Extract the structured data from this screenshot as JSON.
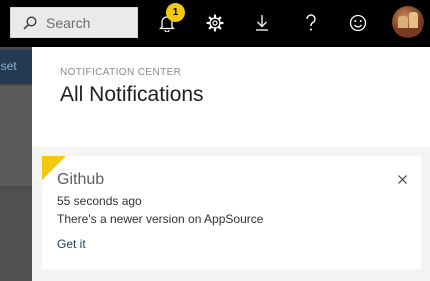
{
  "header": {
    "search_placeholder": "Search",
    "notification_count": "1"
  },
  "background": {
    "partial_label": "eset"
  },
  "notification_center": {
    "eyebrow": "NOTIFICATION CENTER",
    "title": "All Notifications",
    "notifications": [
      {
        "title": "Github",
        "time": "55 seconds ago",
        "message": "There's a newer version on AppSource",
        "action": "Get it",
        "accent_color": "#f2c811"
      }
    ]
  },
  "icons": {
    "search": "search-icon",
    "bell": "bell-icon",
    "settings": "gear-icon",
    "download": "download-icon",
    "help": "question-icon",
    "feedback": "smiley-icon",
    "close": "close-icon"
  },
  "colors": {
    "topbar": "#000000",
    "badge": "#f2c811",
    "panel_bg": "#f4f4f4"
  }
}
